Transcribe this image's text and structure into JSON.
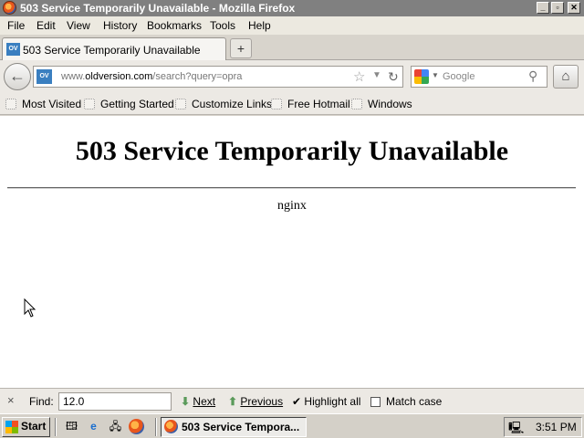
{
  "window": {
    "title": "503 Service Temporarily Unavailable - Mozilla Firefox",
    "controls": [
      "_",
      "▫",
      "✕"
    ]
  },
  "menu": [
    "File",
    "Edit",
    "View",
    "History",
    "Bookmarks",
    "Tools",
    "Help"
  ],
  "tabs": [
    {
      "label": "503 Service Temporarily Unavailable",
      "favicon_text": "OV",
      "active": true
    }
  ],
  "newtab_label": "+",
  "nav": {
    "back_glyph": "←",
    "url_prefix": "www.",
    "url_domain": "oldversion.com",
    "url_path": "/search?query=opra",
    "site_favicon_text": "OV",
    "search_placeholder": "Google",
    "home_glyph": "⌂"
  },
  "bookmarks": [
    "Most Visited",
    "Getting Started",
    "Customize Links",
    "Free Hotmail",
    "Windows"
  ],
  "page": {
    "heading": "503 Service Temporarily Unavailable",
    "server": "nginx"
  },
  "findbar": {
    "close_glyph": "×",
    "label": "Find:",
    "value": "12.0",
    "next": "Next",
    "previous": "Previous",
    "highlight_all": "Highlight all",
    "match_case": "Match case"
  },
  "taskbar": {
    "start": "Start",
    "task_label": "503 Service Tempora...",
    "clock": "3:51 PM"
  }
}
